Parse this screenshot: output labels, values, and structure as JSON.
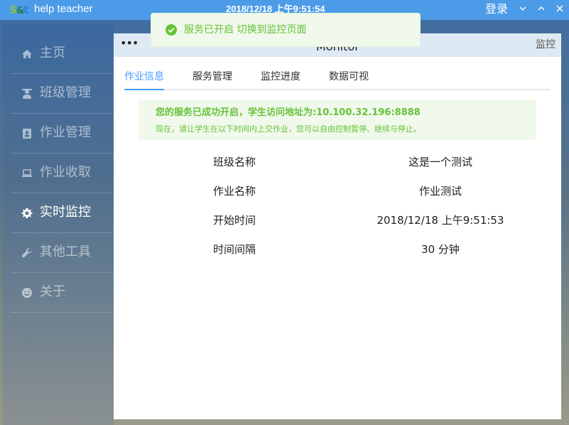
{
  "titlebar": {
    "logo": "app-logo",
    "title": "help teacher",
    "clock": "2018/12/18 上午9:51:54",
    "login": "登录",
    "controls": [
      "chevron-down-icon",
      "chevron-up-icon",
      "close-icon"
    ]
  },
  "sidebar": {
    "items": [
      {
        "label": "主页",
        "icon": "home-icon",
        "active": false
      },
      {
        "label": "班级管理",
        "icon": "teacher-icon",
        "active": false
      },
      {
        "label": "作业管理",
        "icon": "contact-card-icon",
        "active": false
      },
      {
        "label": "作业收取",
        "icon": "laptop-icon",
        "active": false
      },
      {
        "label": "实时监控",
        "icon": "gear-icon",
        "active": true
      },
      {
        "label": "其他工具",
        "icon": "wrench-icon",
        "active": false
      },
      {
        "label": "关于",
        "icon": "smile-icon",
        "active": false
      }
    ]
  },
  "panel": {
    "menu": "•••",
    "title": "Monitor",
    "tag": "监控",
    "tabs": [
      {
        "label": "作业信息",
        "active": true
      },
      {
        "label": "服务管理",
        "active": false
      },
      {
        "label": "监控进度",
        "active": false
      },
      {
        "label": "数据可视",
        "active": false
      }
    ],
    "alert": {
      "title": "您的服务已成功开启，学生访问地址为:10.100.32.196:8888",
      "description": "现在，请让学生在以下时间内上交作业，您可以自由控制暂停、继续与停止。"
    },
    "info": [
      {
        "key": "班级名称",
        "value": "这是一个测试"
      },
      {
        "key": "作业名称",
        "value": "作业测试"
      },
      {
        "key": "开始时间",
        "value": "2018/12/18 上午9:51:53"
      },
      {
        "key": "时间间隔",
        "value": "30 分钟"
      }
    ]
  },
  "toast": {
    "icon": "check-circle-icon",
    "text": "服务已开启 切换到监控页面"
  },
  "colors": {
    "titlebar": "#4c9be8",
    "accent": "#409eff",
    "success": "#67c23a",
    "success_bg": "#f0f9eb"
  }
}
